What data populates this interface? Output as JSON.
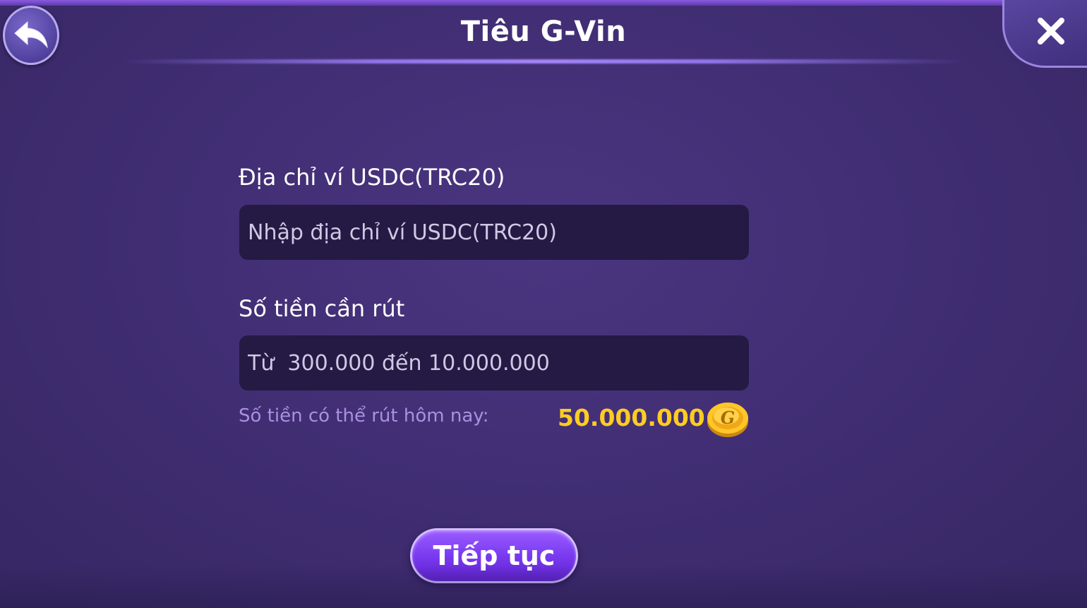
{
  "header": {
    "title": "Tiêu G-Vin",
    "back_icon": "back-arrow-icon",
    "close_icon": "close-icon"
  },
  "form": {
    "wallet": {
      "label": "Địa chỉ ví USDC(TRC20)",
      "placeholder": "Nhập địa chỉ ví USDC(TRC20)",
      "value": ""
    },
    "amount": {
      "label": "Số tiền cần rút",
      "placeholder": "Từ  300.000 đến 10.000.000",
      "value": ""
    },
    "daily_limit": {
      "label": "Số tiền có thể rút hôm nay:",
      "value": "50.000.000",
      "icon": "gold-coin-icon"
    }
  },
  "actions": {
    "continue_label": "Tiếp tục"
  },
  "colors": {
    "background": "#412e74",
    "accent": "#7a3af0",
    "amount_highlight": "#ffcc22",
    "hint_text": "#a891e0"
  }
}
